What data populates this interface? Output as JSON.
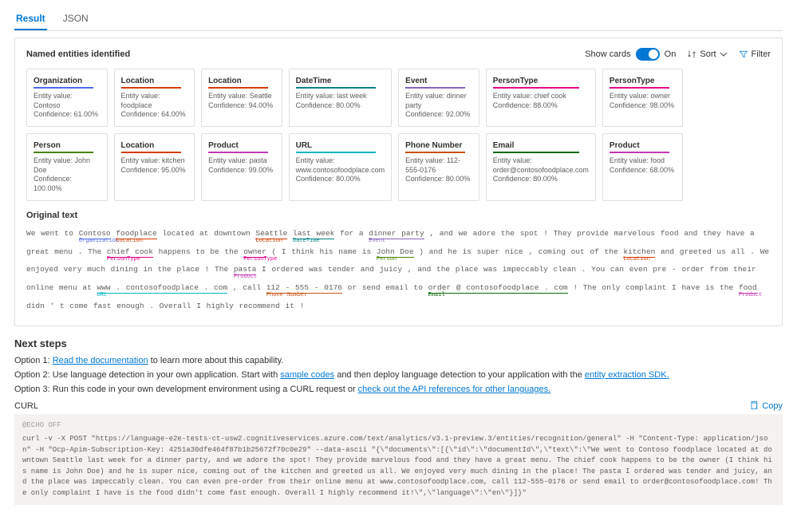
{
  "tabs": {
    "result": "Result",
    "json": "JSON"
  },
  "panel": {
    "title": "Named entities identified",
    "show_cards": "Show cards",
    "toggle_state": "On",
    "sort": "Sort",
    "filter": "Filter"
  },
  "colors": {
    "Organization": "#4f6bed",
    "Location": "#d83b01",
    "DateTime": "#038387",
    "Event": "#8764b8",
    "PersonType": "#e3008c",
    "Person": "#498205",
    "Product": "#c239b3",
    "URL": "#00b7c3",
    "Phone Number": "#ca5010",
    "Email": "#0b6a0b"
  },
  "cards": [
    {
      "type": "Organization",
      "value": "Contoso",
      "conf": "61.00%"
    },
    {
      "type": "Location",
      "value": "foodplace",
      "conf": "64.00%"
    },
    {
      "type": "Location",
      "value": "Seattle",
      "conf": "94.00%"
    },
    {
      "type": "DateTime",
      "value": "last week",
      "conf": "80.00%"
    },
    {
      "type": "Event",
      "value": "dinner party",
      "conf": "92.00%"
    },
    {
      "type": "PersonType",
      "value": "chief cook",
      "conf": "88.00%"
    },
    {
      "type": "PersonType",
      "value": "owner",
      "conf": "98.00%"
    },
    {
      "type": "Person",
      "value": "John Doe",
      "conf": "100.00%"
    },
    {
      "type": "Location",
      "value": "kitchen",
      "conf": "95.00%"
    },
    {
      "type": "Product",
      "value": "pasta",
      "conf": "99.00%"
    },
    {
      "type": "URL",
      "value": "www.contosofoodplace.com",
      "conf": "80.00%"
    },
    {
      "type": "Phone Number",
      "value": "112-555-0176",
      "conf": "80.00%"
    },
    {
      "type": "Email",
      "value": "order@contosofoodplace.com",
      "conf": "80.00%"
    },
    {
      "type": "Product",
      "value": "food",
      "conf": "68.00%"
    }
  ],
  "labels": {
    "entity_value": "Entity value:",
    "confidence": "Confidence:"
  },
  "orig": {
    "title": "Original text",
    "tokens": [
      {
        "t": "We went to "
      },
      {
        "t": "Contoso",
        "e": "Organization"
      },
      {
        "t": " "
      },
      {
        "t": "foodplace",
        "e": "Location"
      },
      {
        "t": " located at downtown "
      },
      {
        "t": "Seattle",
        "e": "Location"
      },
      {
        "t": " "
      },
      {
        "t": "last week",
        "e": "DateTime"
      },
      {
        "t": " for a "
      },
      {
        "t": "dinner party",
        "e": "Event"
      },
      {
        "t": " , and we adore the spot ! They provide marvelous food and they have a great menu . The "
      },
      {
        "t": "chief cook",
        "e": "PersonType"
      },
      {
        "t": " happens to be the "
      },
      {
        "t": "owner",
        "e": "PersonType"
      },
      {
        "t": " ( I think his name is "
      },
      {
        "t": "John Doe",
        "e": "Person"
      },
      {
        "t": " ) and he is super nice , coming out of the "
      },
      {
        "t": "kitchen",
        "e": "Location"
      },
      {
        "t": " and greeted us all . We enjoyed very much dining in the place ! The "
      },
      {
        "t": "pasta",
        "e": "Product"
      },
      {
        "t": " I ordered was tender and juicy , and the place was impeccably clean . You can even pre - order from their online menu at "
      },
      {
        "t": "www . contosofoodplace . com",
        "e": "URL"
      },
      {
        "t": " , call "
      },
      {
        "t": "112 - 555 - 0176",
        "e": "Phone Number"
      },
      {
        "t": " or send email to "
      },
      {
        "t": "order @ contosofoodplace . com",
        "e": "Email"
      },
      {
        "t": " ! The only complaint I have is the "
      },
      {
        "t": "food",
        "e": "Product"
      },
      {
        "t": " didn ' t come fast enough . Overall I highly recommend it !"
      }
    ]
  },
  "next": {
    "title": "Next steps",
    "opt1_a": "Option 1: ",
    "opt1_link": "Read the documentation",
    "opt1_b": " to learn more about this capability.",
    "opt2_a": "Option 2: Use language detection in your own application. Start with ",
    "opt2_link1": "sample codes",
    "opt2_b": " and then deploy language detection to your application with the ",
    "opt2_link2": "entity extraction SDK.",
    "opt3_a": "Option 3: Run this code in your own development environment using a CURL request or ",
    "opt3_link": "check out the API references for other languages."
  },
  "curl": {
    "label": "CURL",
    "copy": "Copy",
    "line1": "@ECHO OFF",
    "body": "curl -v -X POST \"https://language-e2e-tests-ct-usw2.cognitiveservices.azure.com/text/analytics/v3.1-preview.3/entities/recognition/general\" -H \"Content-Type: application/json\" -H \"Ocp-Apim-Subscription-Key: 4251a30dfe464f87b1b25672f70c0e29\" --data-ascii \"{\\\"documents\\\":[{\\\"id\\\":\\\"documentId\\\",\\\"text\\\":\\\"We went to Contoso foodplace located at downtown Seattle last week for a dinner party, and we adore the spot! They provide marvelous food and they have a great menu. The chief cook happens to be the owner (I think his name is John Doe) and he is super nice, coming out of the kitchen and greeted us all. We enjoyed very much dining in the place! The pasta I ordered was tender and juicy, and the place was impeccably clean. You can even pre-order from their online menu at www.contosofoodplace.com, call 112-555-0176 or send email to order@contosofoodplace.com! The only complaint I have is the food didn't come fast enough. Overall I highly recommend it!\\\",\\\"language\\\":\\\"en\\\"}]}\""
  }
}
